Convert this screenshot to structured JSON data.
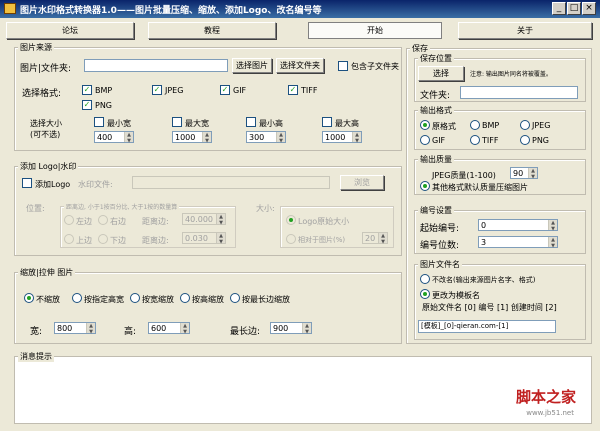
{
  "window": {
    "title": "图片水印格式转换器1.0——图片批量压缩、缩放、添加Logo、改名编号等",
    "min": "_",
    "max": "□",
    "close": "×"
  },
  "toolbar": {
    "forum": "论坛",
    "tutorial": "教程",
    "start": "开始",
    "about": "关于"
  },
  "source": {
    "group": "图片来源",
    "path_label": "图片|文件夹:",
    "path_value": "",
    "select_image": "选择图片",
    "select_folder": "选择文件夹",
    "include_subfolders": "包含子文件夹",
    "formats_label": "选择格式:",
    "formats": [
      "BMP",
      "JPEG",
      "GIF",
      "TIFF",
      "PNG"
    ],
    "size_label": "选择大小",
    "size_label2": "(可不选)",
    "min_width": "最小宽",
    "max_width": "最大宽",
    "min_height": "最小高",
    "max_height": "最大高",
    "min_width_val": "400",
    "max_width_val": "1000",
    "min_height_val": "300",
    "max_height_val": "1000"
  },
  "logo": {
    "group": "添加 Logo|水印",
    "add_logo": "添加Logo",
    "file_label": "水印文件:",
    "browse": "浏览",
    "position_label": "位置:",
    "hint": "距离边, 小于1按百分比, 大于1按的数量算",
    "left": "左边",
    "right": "右边",
    "top": "上边",
    "bottom": "下边",
    "margin_h_label": "距离边:",
    "margin_h_val": "40.000",
    "margin_v_label": "距离边:",
    "margin_v_val": "0.030",
    "size_label": "大小:",
    "original_size": "Logo原始大小",
    "relative": "相对于图片(%)",
    "relative_val": "20"
  },
  "scale": {
    "group": "缩放|拉伸 图片",
    "options": [
      "不缩放",
      "按指定高宽",
      "按宽缩放",
      "按高缩放",
      "按最长边缩放"
    ],
    "width_label": "宽:",
    "width_val": "800",
    "height_label": "高:",
    "height_val": "600",
    "longest_label": "最长边:",
    "longest_val": "900"
  },
  "message": {
    "group": "消息提示"
  },
  "save": {
    "group": "保存",
    "location_group": "保存位置",
    "select": "选择",
    "note": "注意: 输出图片同名将被覆盖。",
    "folder_label": "文件夹:",
    "folder_val": "",
    "format_group": "输出格式",
    "formats": [
      "原格式",
      "BMP",
      "JPEG",
      "GIF",
      "TIFF",
      "PNG"
    ],
    "quality_group": "输出质量",
    "jpeg_quality_label": "JPEG质量(1-100)",
    "jpeg_quality_val": "90",
    "compress_other": "其他格式默认质量压缩图片",
    "numbering_group": "编号设置",
    "start_label": "起始编号:",
    "start_val": "0",
    "digits_label": "编号位数:",
    "digits_val": "3",
    "filename_group": "图片文件名",
    "keep_name": "不改名(输出来源图片名字、格式)",
    "template_name": "更改为模板名",
    "template_vars": "原始文件名 [0]  编号 [1]  创建时间 [2]",
    "template_val": "[模板]_[0]-qieran.com-[1]"
  },
  "watermark": {
    "site": "脚本之家",
    "url": "www.jb51.net"
  }
}
